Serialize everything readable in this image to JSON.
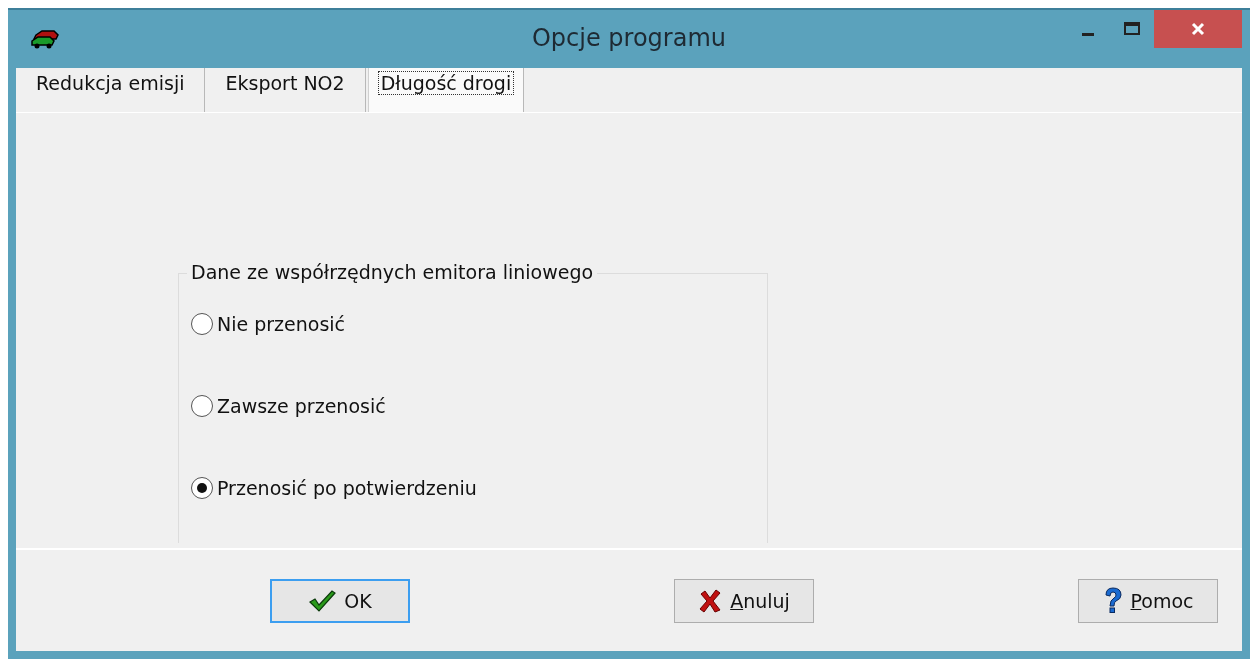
{
  "window": {
    "title": "Opcje programu"
  },
  "tabs": [
    {
      "label": "Redukcja emisji",
      "selected": false
    },
    {
      "label": "Eksport NO2",
      "selected": false
    },
    {
      "label": "Długość drogi",
      "selected": true
    }
  ],
  "group": {
    "title": "Dane ze współrzędnych emitora liniowego",
    "options": [
      {
        "label": "Nie przenosić",
        "selected": false
      },
      {
        "label": "Zawsze przenosić",
        "selected": false
      },
      {
        "label": "Przenosić po potwierdzeniu",
        "selected": true
      }
    ]
  },
  "buttons": [
    {
      "kind": "ok",
      "label": "OK",
      "default": true
    },
    {
      "kind": "cancel",
      "label": "Anuluj",
      "default": false
    },
    {
      "kind": "help",
      "label": "Pomoc",
      "default": false
    }
  ]
}
